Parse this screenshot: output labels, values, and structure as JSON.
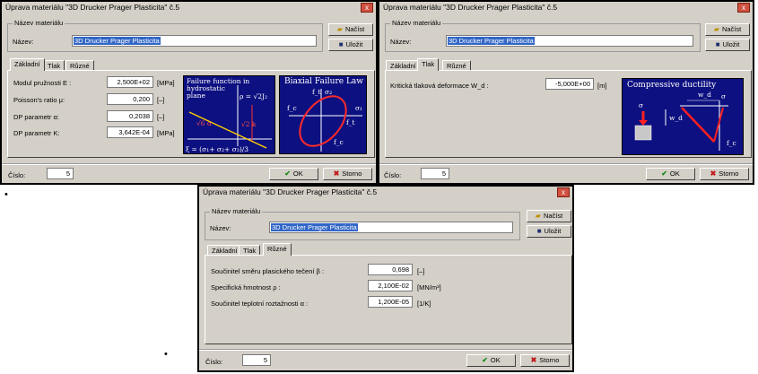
{
  "common": {
    "title": "Úprava materiálu \"3D Drucker Prager Plasticita\" č.5",
    "close_glyph": "x",
    "group_label": "Název materiálu",
    "name_label": "Název:",
    "name_value": "3D Drucker Prager Plasticita",
    "load_button": "Načíst",
    "save_button": "Uložit",
    "tabs": [
      "Základní",
      "Tlak",
      "Různé"
    ],
    "number_label": "Číslo:",
    "number_value": "5",
    "ok_button": "OK",
    "cancel_button": "Storno"
  },
  "basic": {
    "rows": [
      {
        "label": "Modul pružnosti E :",
        "value": "2,500E+02",
        "unit": "[MPa]"
      },
      {
        "label": "Poisson's ratio μ:",
        "value": "0,200",
        "unit": "[–]"
      },
      {
        "label": "DP parametr α:",
        "value": "0,2038",
        "unit": "[–]"
      },
      {
        "label": "DP parametr K:",
        "value": "3,642E-04",
        "unit": "[MPa]"
      }
    ],
    "fig1": {
      "title_lines": [
        "Failure function in",
        "hydrostatic",
        "plane"
      ],
      "rho": "ρ = √2J₂",
      "root6": "√6 α",
      "root2k": "√2 k",
      "xi": "ξ = (σ₁+ σ₂+ σ₃)/3"
    },
    "fig2": {
      "title": "Biaxial Failure Law",
      "s1": "σ₁",
      "s2": "σ₂",
      "ft": "f_t",
      "fc": "f_c"
    }
  },
  "pressure": {
    "label": "Kritická tlaková deformace W_d :",
    "value": "-5,000E+00",
    "unit": "[m]",
    "fig": {
      "title": "Compressive ductility",
      "wd": "w_d",
      "sigma": "σ",
      "fc": "f_c"
    }
  },
  "misc": {
    "rows": [
      {
        "label": "Součinitel směru plasického tečení β :",
        "value": "0,698",
        "unit": "[–]"
      },
      {
        "label": "Specifická hmotnost ρ :",
        "value": "2,100E-02",
        "unit": "[MN/m³]"
      },
      {
        "label": "Součinitel teplotní roztažnosti α :",
        "value": "1,200E-05",
        "unit": "[1/K]"
      }
    ]
  },
  "bullets": [
    "•",
    "•"
  ]
}
